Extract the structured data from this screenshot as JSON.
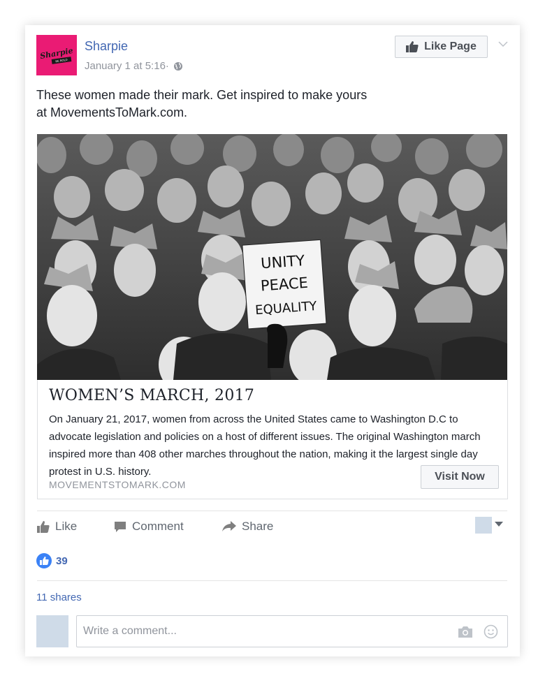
{
  "post": {
    "page_name": "Sharpie",
    "timestamp": "January 1 at 5:16·",
    "avatar_logo": "Sharpie",
    "avatar_tag": "BE BOLD",
    "like_page_label": "Like Page",
    "text_line1": "These women made their mark. Get inspired to make yours",
    "text_line2": "at MovementsToMark.com."
  },
  "link": {
    "title": "WOMEN’S MARCH, 2017",
    "description": "On January 21, 2017, women from across the United States came to Washington D.C to advocate legislation and policies on a host of different issues. The original Washington march inspired more than 408 other marches throughout the nation, making it the largest single day protest in U.S. history.",
    "domain": "MOVEMENTSTOMARK.COM",
    "cta": "Visit Now",
    "sign_text": [
      "UNITY",
      "PEACE",
      "EQUALITY"
    ]
  },
  "actions": {
    "like": "Like",
    "comment": "Comment",
    "share": "Share"
  },
  "stats": {
    "reactions": "39",
    "shares": "11 shares"
  },
  "comment": {
    "placeholder": "Write a comment..."
  },
  "colors": {
    "brand_pink": "#ea1b74",
    "link_blue": "#4267b2",
    "reaction_blue": "#3b82f6"
  }
}
